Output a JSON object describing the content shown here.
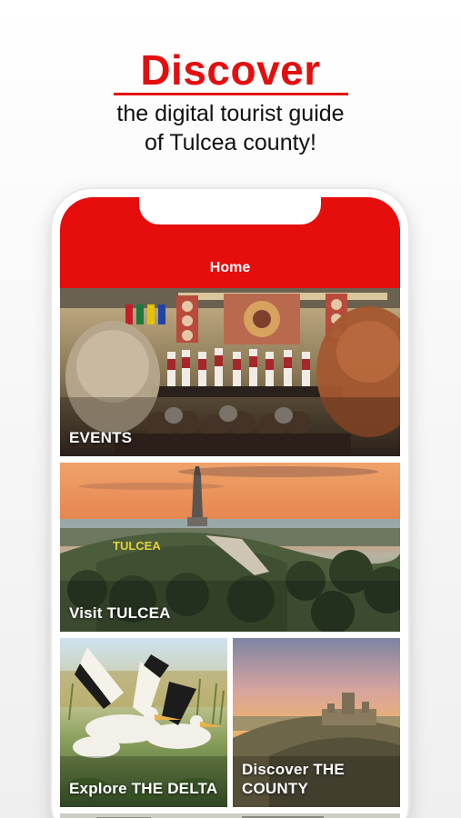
{
  "promo": {
    "headline": "Discover",
    "subline_1": "the digital tourist guide",
    "subline_2": "of Tulcea county!"
  },
  "app": {
    "title": "Home",
    "accent_color": "#e60d0d"
  },
  "tiles": [
    {
      "label": "EVENTS",
      "image": "folk-festival-stage-photo"
    },
    {
      "label": "Visit TULCEA",
      "image": "tulcea-monument-hill-sunset-photo"
    },
    {
      "label": "Explore THE DELTA",
      "image": "pelicans-photo"
    },
    {
      "label": "Discover THE COUNTY",
      "image": "fortress-ruins-sunset-photo"
    }
  ]
}
